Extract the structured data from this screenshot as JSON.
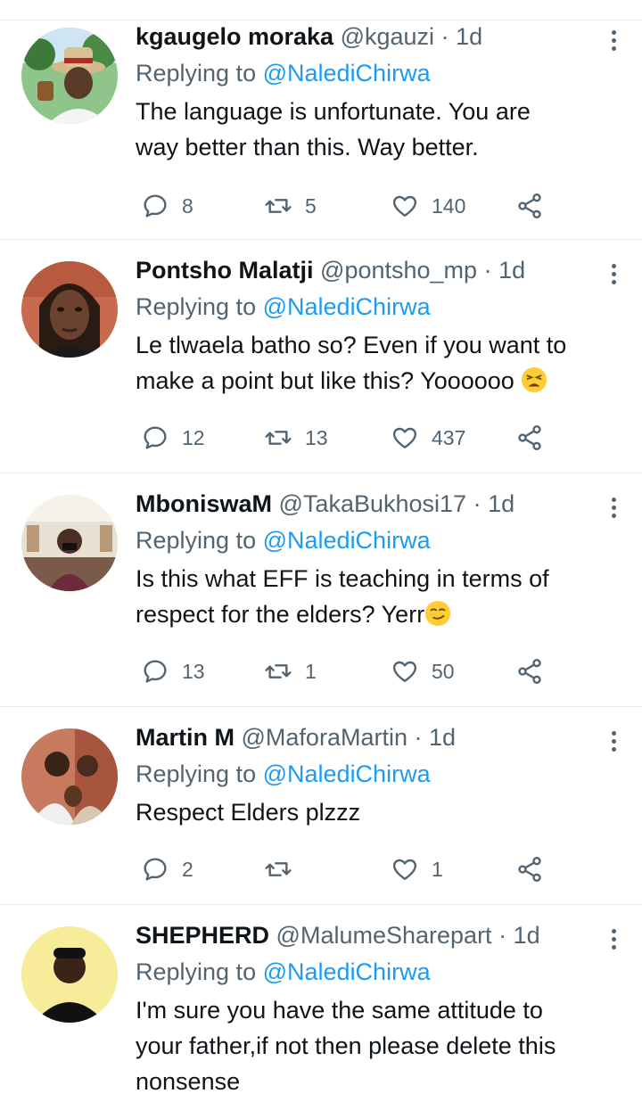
{
  "tweets": [
    {
      "name": "kgaugelo moraka",
      "handle": "@kgauzi",
      "time": "1d",
      "replying_prefix": "Replying to",
      "replying_to": "@NalediChirwa",
      "lines": [
        "The language is unfortunate. You are",
        "way better than this. Way better."
      ],
      "replies": "8",
      "retweets": "5",
      "likes": "140",
      "avatar_bg": "#7fb37a"
    },
    {
      "name": "Pontsho Malatji",
      "handle": "@pontsho_mp",
      "time": "1d",
      "replying_prefix": "Replying to",
      "replying_to": "@NalediChirwa",
      "lines": [
        "Le tlwaela batho so? Even if you want to",
        "make a point but like this? Yoooooo"
      ],
      "replies": "12",
      "retweets": "13",
      "likes": "437",
      "avatar_bg": "#c86a4e"
    },
    {
      "name": "MboniswaM",
      "handle": "@TakaBukhosi17",
      "time": "1d",
      "replying_prefix": "Replying to",
      "replying_to": "@NalediChirwa",
      "lines": [
        "Is this what EFF is teaching in terms of",
        "respect for the elders? Yerr"
      ],
      "replies": "13",
      "retweets": "1",
      "likes": "50",
      "avatar_bg": "#d8cbb8"
    },
    {
      "name": "Martin M",
      "handle": "@MaforaMartin",
      "time": "1d",
      "replying_prefix": "Replying to",
      "replying_to": "@NalediChirwa",
      "lines": [
        "Respect Elders plzzz"
      ],
      "replies": "2",
      "retweets": "",
      "likes": "1",
      "avatar_bg": "#b86a52"
    },
    {
      "name": "SHEPHERD",
      "handle": "@MalumeSharepart",
      "time": "1d",
      "replying_prefix": "Replying to",
      "replying_to": "@NalediChirwa",
      "lines": [
        "I'm sure you have the same attitude to",
        "your father,if not then please delete this",
        "nonsense"
      ],
      "replies": "",
      "retweets": "",
      "likes": "",
      "avatar_bg": "#f2e27a"
    }
  ]
}
